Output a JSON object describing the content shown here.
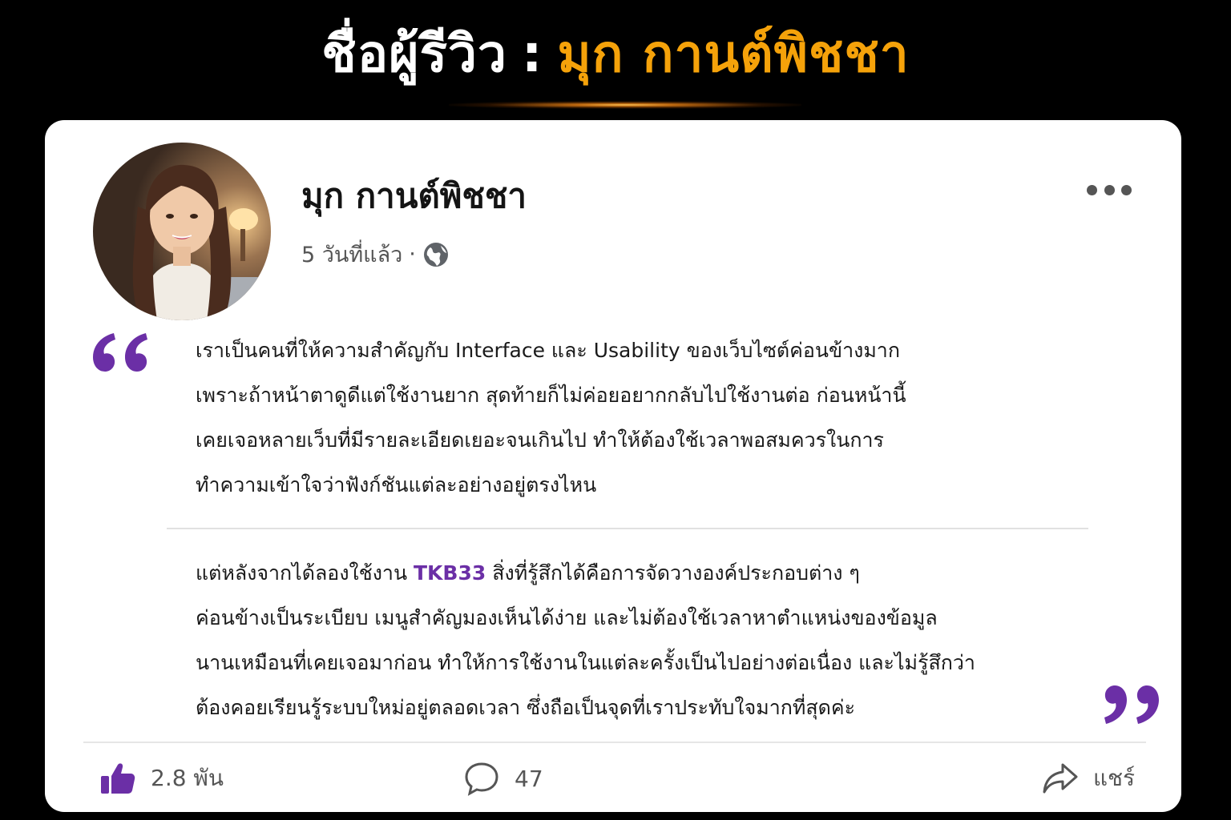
{
  "header": {
    "label": "ชื่อผู้รีวิว",
    "separator": ":",
    "reviewer_name": "มุก กานต์พิชชา",
    "accent_color": "#f5a20a"
  },
  "post": {
    "author": "มุก กานต์พิชชา",
    "timestamp": "5 วันที่แล้ว",
    "dot": "·",
    "visibility_icon": "globe-icon",
    "menu_icon": "more-options-icon",
    "avatar": "avatar-photo"
  },
  "review": {
    "paragraph1": [
      "เราเป็นคนที่ให้ความสำคัญกับ Interface และ Usability ของเว็บไซต์ค่อนข้างมาก",
      "เพราะถ้าหน้าตาดูดีแต่ใช้งานยาก สุดท้ายก็ไม่ค่อยอยากกลับไปใช้งานต่อ ก่อนหน้านี้",
      "เคยเจอหลายเว็บที่มีรายละเอียดเยอะจนเกินไป ทำให้ต้องใช้เวลาพอสมควรในการ",
      "ทำความเข้าใจว่าฟังก์ชันแต่ละอย่างอยู่ตรงไหน"
    ],
    "paragraph2_line1_before": "แต่หลังจากได้ลองใช้งาน ",
    "brand": "TKB33",
    "paragraph2_line1_after": "  สิ่งที่รู้สึกได้คือการจัดวางองค์ประกอบต่าง ๆ",
    "paragraph2_rest": [
      "ค่อนข้างเป็นระเบียบ เมนูสำคัญมองเห็นได้ง่าย และไม่ต้องใช้เวลาหาตำแหน่งของข้อมูล",
      "นานเหมือนที่เคยเจอมาก่อน ทำให้การใช้งานในแต่ละครั้งเป็นไปอย่างต่อเนื่อง และไม่รู้สึกว่า",
      "ต้องคอยเรียนรู้ระบบใหม่อยู่ตลอดเวลา ซึ่งถือเป็นจุดที่เราประทับใจมากที่สุดค่ะ"
    ],
    "brand_color": "#6b2fa6",
    "quote_color": "#6b2fa6"
  },
  "actions": {
    "like_count": "2.8 พัน",
    "comment_count": "47",
    "share_label": "แชร์",
    "like_color": "#6b2fa6"
  }
}
